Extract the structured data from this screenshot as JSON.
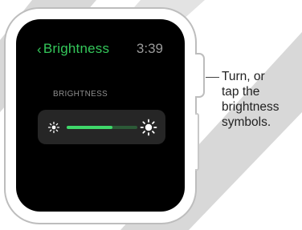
{
  "header": {
    "back_chevron": "‹",
    "back_label": "Brightness",
    "time": "3:39"
  },
  "brightness": {
    "section_label": "BRIGHTNESS",
    "level": 0.65,
    "decrease_icon": "sun-small-icon",
    "increase_icon": "sun-large-icon"
  },
  "caption": {
    "lines": [
      "Turn, or",
      "tap the",
      "brightness",
      "symbols."
    ]
  },
  "colors": {
    "accent": "#34c75a",
    "screen": "#000000",
    "control_bg": "#262626",
    "track_fill": "#3fd86a"
  }
}
